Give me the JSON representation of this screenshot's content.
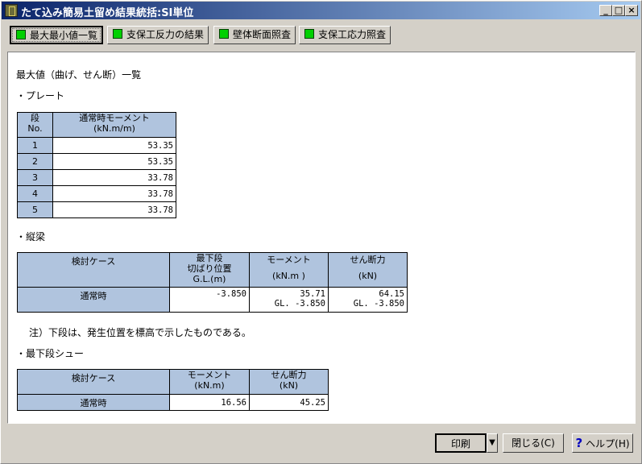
{
  "window": {
    "title": "たて込み簡易土留め結果統括:SI単位",
    "min_label": "_",
    "max_label": "□",
    "close_label": "×"
  },
  "tabs": [
    {
      "label": "最大最小値一覧"
    },
    {
      "label": "支保工反力の結果"
    },
    {
      "label": "壁体断面照査"
    },
    {
      "label": "支保工応力照査"
    }
  ],
  "content": {
    "heading": "最大値（曲げ、せん断）一覧",
    "plate": {
      "section": "・プレート",
      "col1": [
        "段",
        "No."
      ],
      "col2": [
        "通常時モーメント",
        "(kN.m/m)"
      ],
      "rows": [
        {
          "no": "1",
          "value": "53.35"
        },
        {
          "no": "2",
          "value": "53.35"
        },
        {
          "no": "3",
          "value": "33.78"
        },
        {
          "no": "4",
          "value": "33.78"
        },
        {
          "no": "5",
          "value": "33.78"
        }
      ]
    },
    "beam": {
      "section": "・縦梁",
      "headers": {
        "case": "検討ケース",
        "pos": [
          "最下段",
          "切ばり位置",
          "G.L.(m)"
        ],
        "moment": [
          "モーメント",
          "(kN.m )"
        ],
        "shear": [
          "せん断力",
          "(kN)"
        ]
      },
      "row": {
        "case": "通常時",
        "pos": "-3.850",
        "moment": [
          "35.71",
          "GL. -3.850"
        ],
        "shear": [
          "64.15",
          "GL. -3.850"
        ]
      },
      "note": "注）下段は、発生位置を標高で示したものである。"
    },
    "shoe": {
      "section": "・最下段シュー",
      "headers": {
        "case": "検討ケース",
        "moment": [
          "モーメント",
          "(kN.m)"
        ],
        "shear": [
          "せん断力",
          "(kN)"
        ]
      },
      "row": {
        "case": "通常時",
        "moment": "16.56",
        "shear": "45.25"
      }
    }
  },
  "buttons": {
    "print": "印刷",
    "close": "閉じる(C)",
    "help": "ヘルプ(H)",
    "dropdown": "▼",
    "help_icon": "?"
  }
}
